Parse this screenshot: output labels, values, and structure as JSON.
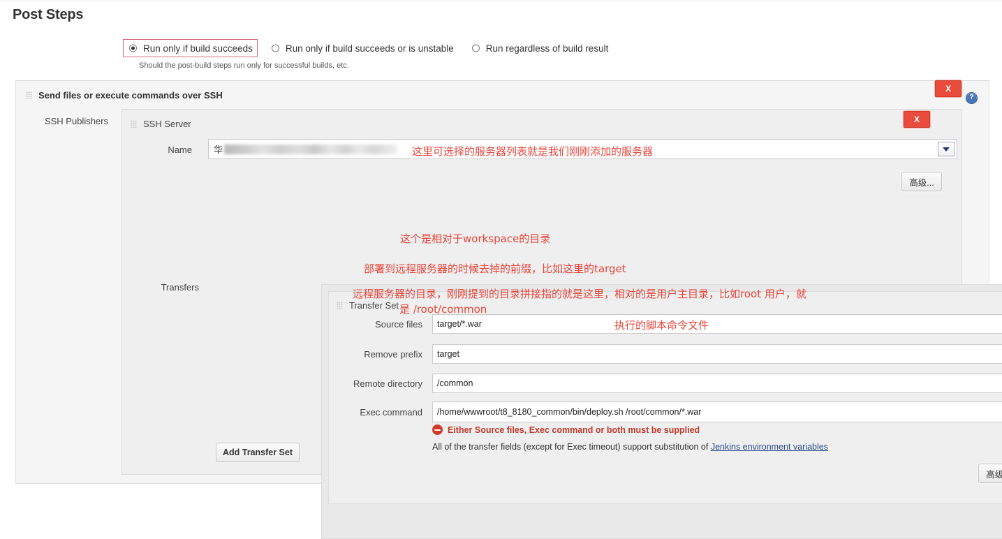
{
  "page": {
    "title": "Post Steps"
  },
  "run_condition": {
    "options": [
      {
        "label": "Run only if build succeeds",
        "selected": true
      },
      {
        "label": "Run only if build succeeds or is unstable",
        "selected": false
      },
      {
        "label": "Run regardless of build result",
        "selected": false
      }
    ],
    "hint": "Should the post-build steps run only for successful builds, etc."
  },
  "block": {
    "title": "Send files or execute commands over SSH",
    "delete_label": "X",
    "help_label": "?",
    "publishers_label": "SSH Publishers"
  },
  "ssh_server": {
    "title": "SSH Server",
    "delete_label": "X",
    "name_label": "Name",
    "name_value": "华",
    "name_note": "这里可选择的服务器列表就是我们刚刚添加的服务器",
    "advanced_label": "高级...",
    "transfers_label": "Transfers"
  },
  "transfer_set": {
    "title": "Transfer Set",
    "fields": [
      {
        "label": "Source files",
        "value": "target/*.war",
        "note": "这个是相对于workspace的目录"
      },
      {
        "label": "Remove prefix",
        "value": "target",
        "note": "部署到远程服务器的时候去掉的前缀，比如这里的target"
      },
      {
        "label": "Remote directory",
        "value": "/common",
        "note": "远程服务器的目录，刚刚提到的目录拼接指的就是这里，相对的是用户主目录，比如root 用户，就",
        "note2": "是 /root/common"
      },
      {
        "label": "Exec command",
        "value": "/home/wwwroot/t8_8180_common/bin/deploy.sh /root/common/*.war",
        "note": "执行的脚本命令文件"
      }
    ],
    "error_message": "Either Source files, Exec command or both must be supplied",
    "help_text_prefix": "All of the transfer fields (except for Exec timeout) support substitution of ",
    "help_link": "Jenkins environment variables",
    "advanced_label": "高级...",
    "add_label": "Add Transfer Set"
  },
  "colors": {
    "accent_red": "#e8443a",
    "delete_red": "#e74c3c",
    "help_blue": "#4a77b8",
    "error_red": "#c0392b",
    "link_blue": "#2a4d8f"
  }
}
